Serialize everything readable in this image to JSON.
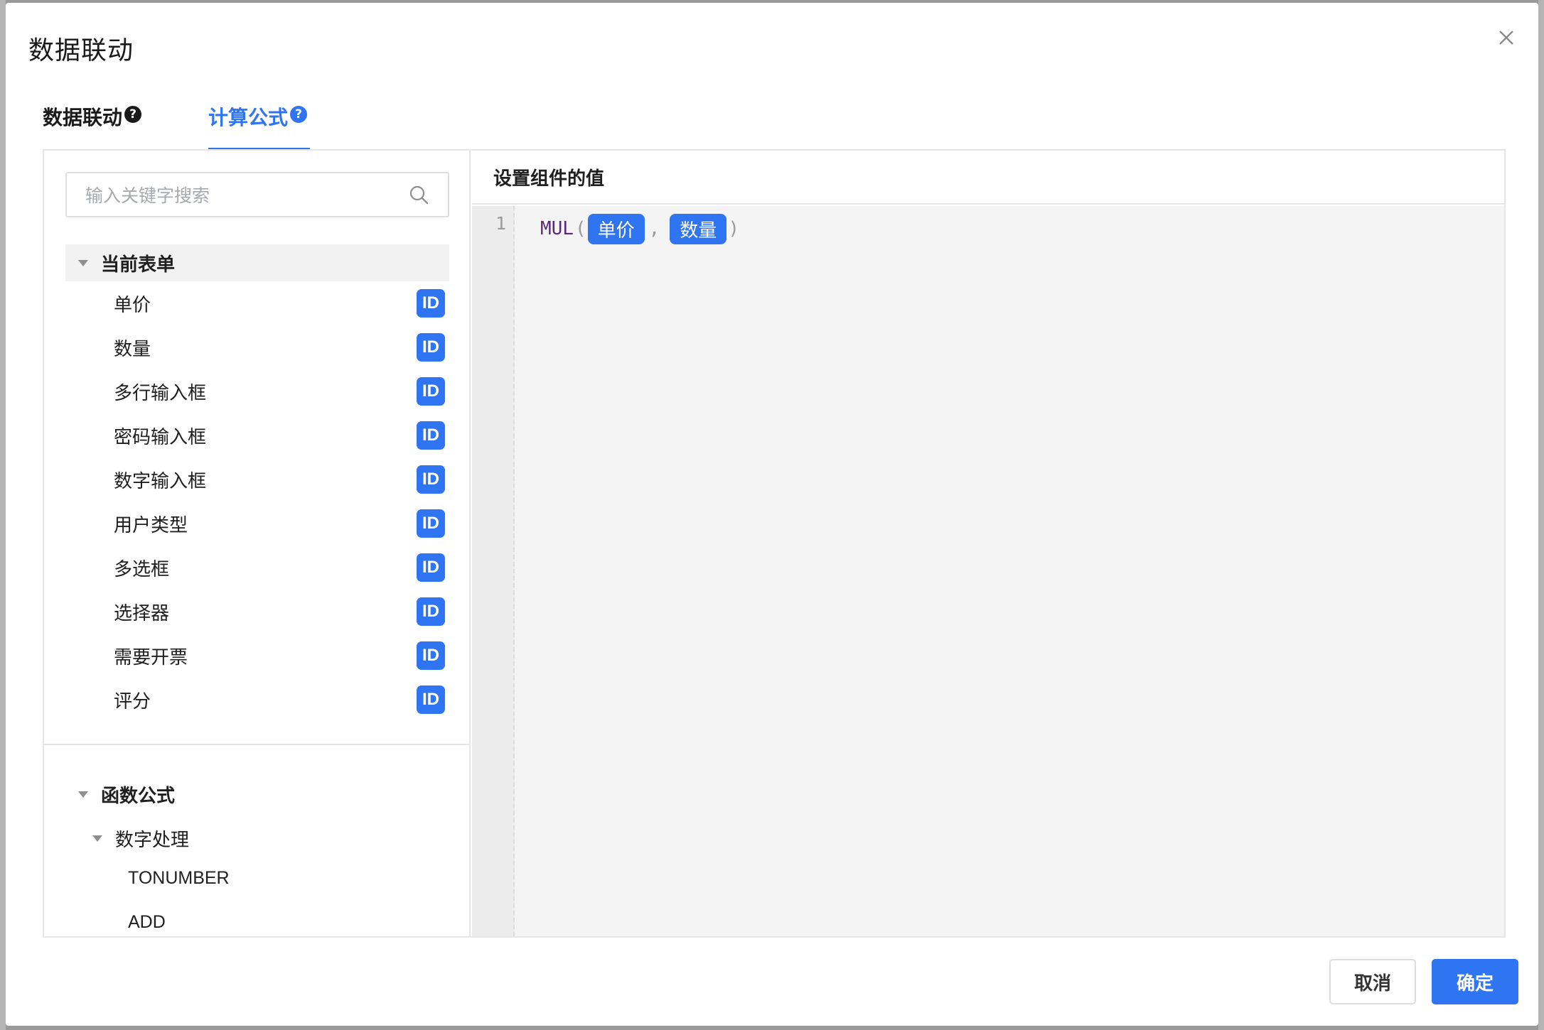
{
  "dialog": {
    "title": "数据联动",
    "close_icon": "close-icon"
  },
  "tabs": [
    {
      "label": "数据联动",
      "help": "?",
      "active": false
    },
    {
      "label": "计算公式",
      "help": "?",
      "active": true
    }
  ],
  "sidebar": {
    "search_placeholder": "输入关键字搜索",
    "current_form": {
      "title": "当前表单",
      "badge": "ID",
      "fields": [
        "单价",
        "数量",
        "多行输入框",
        "密码输入框",
        "数字输入框",
        "用户类型",
        "多选框",
        "选择器",
        "需要开票",
        "评分"
      ]
    },
    "functions": {
      "title": "函数公式",
      "category": "数字处理",
      "items": [
        "TONUMBER",
        "ADD"
      ]
    }
  },
  "editor": {
    "header": "设置组件的值",
    "line_number": "1",
    "function": "MUL",
    "open_paren": "(",
    "comma": ",",
    "close_paren": ")",
    "args": [
      "单价",
      "数量"
    ]
  },
  "footer": {
    "cancel_label": "取消",
    "ok_label": "确定"
  },
  "colors": {
    "accent": "#2f74f0",
    "function_name": "#5b2a75"
  }
}
